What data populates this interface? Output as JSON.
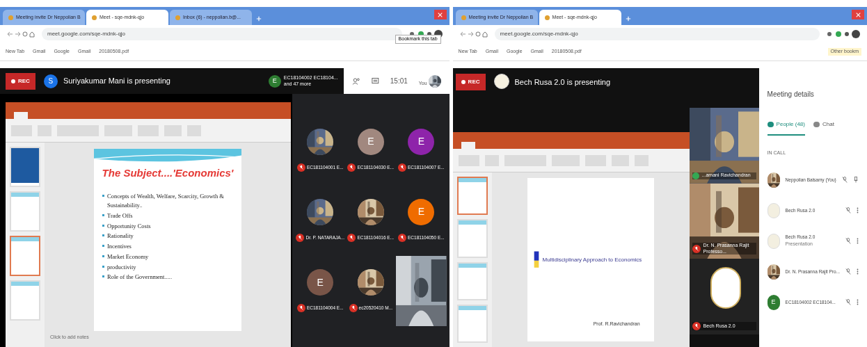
{
  "left_window": {
    "tabs": [
      {
        "title": "Meeting invite Dr Neppolian B",
        "selected": false
      },
      {
        "title": "Meet - sqe-mdnk-qjo",
        "selected": true
      },
      {
        "title": "Inbox (6) - neppolian.b@...",
        "selected": false
      }
    ],
    "url": "meet.google.com/sqe-mdnk-qjo",
    "bookmarks": [
      "New Tab",
      "Gmail",
      "Google",
      "Gmail",
      "20180508.pdf"
    ],
    "tooltip": "Bookmark this tab",
    "rec": "REC",
    "presenter": {
      "initial": "S",
      "text": "Suriyakumar Mani is presenting"
    },
    "participants": {
      "initial": "E",
      "names": "EC18104002 EC18104...",
      "more": "and 47 more"
    },
    "clock": "15:01",
    "self_label": "You",
    "slide": {
      "title": "The Subject....'Economics'",
      "bullets": [
        "Concepts of Wealth, Welfare, Scarcity, Growth & Sustainability..",
        "Trade Offs",
        "Opportunity Costs",
        "Rationality",
        "Incentives",
        "Market Economy",
        "productivity",
        "Role of the Government....."
      ]
    },
    "thumbnails": [
      {
        "selected": false
      },
      {
        "selected": false
      },
      {
        "selected": true
      },
      {
        "selected": false
      }
    ],
    "notes": "Click to add notes",
    "tiles": [
      {
        "kind": "picture",
        "name": "EC181104001 E..."
      },
      {
        "kind": "letter",
        "letter": "E",
        "color": "#a1887f",
        "name": "EC181104030 E..."
      },
      {
        "kind": "letter",
        "letter": "E",
        "color": "#8e24aa",
        "name": "EC181104007 E..."
      },
      {
        "kind": "picture",
        "name": "Dr. P. NATARAJA..."
      },
      {
        "kind": "picture",
        "name": "EC181104016 E..."
      },
      {
        "kind": "letter",
        "letter": "E",
        "color": "#ef6c00",
        "name": "EC181104050 E..."
      },
      {
        "kind": "letter",
        "letter": "E",
        "color": "#795548",
        "name": "EC181104004 E..."
      },
      {
        "kind": "picture",
        "name": "ec20520410 M..."
      },
      {
        "kind": "video"
      }
    ]
  },
  "right_window": {
    "tabs": [
      {
        "title": "Meeting invite Dr Neppolian B",
        "selected": false
      },
      {
        "title": "Meet - sqe-mdnk-qjo",
        "selected": true
      }
    ],
    "url": "meet.google.com/sqe-mdnk-qjo",
    "bookmarks": [
      "New Tab",
      "Gmail",
      "Google",
      "Gmail",
      "20180508.pdf"
    ],
    "other_bookmarks": "Other bookm",
    "rec": "REC",
    "presenter": {
      "text": "Bech Rusa 2.0 is presenting"
    },
    "slide": {
      "title": "Multidisciplinary Approach to Economics",
      "author": "Prof. R.Ravichandran"
    },
    "thumbnails": [
      {
        "selected": true
      },
      {
        "selected": false
      },
      {
        "selected": false
      },
      {
        "selected": false
      }
    ],
    "videos": [
      {
        "name": "...amani Ravichandran",
        "muted": false
      },
      {
        "name": "Dr. N. Prasanna Rajit Professo...",
        "muted": true
      },
      {
        "name": "Bech Rusa 2.0",
        "muted": true
      }
    ],
    "panel": {
      "title": "Meeting details",
      "tabs": [
        {
          "label": "People (48)",
          "selected": true
        },
        {
          "label": "Chat",
          "selected": false
        }
      ],
      "section": "IN CALL",
      "people": [
        {
          "name": "Neppolian Balsamy (You)",
          "kind": "picture",
          "pinnable": true
        },
        {
          "name": "Bech Rusa 2.0",
          "kind": "logo",
          "pinnable": false
        },
        {
          "name": "Bech Rusa 2.0",
          "sub": "Presentation",
          "kind": "logo",
          "pinnable": false
        },
        {
          "name": "Dr. N. Prasanna Rajit Pro...",
          "kind": "picture",
          "pinnable": false
        },
        {
          "name": "EC18104002 EC18104...",
          "kind": "letter",
          "letter": "E",
          "color": "#2e7d32",
          "pinnable": false
        }
      ]
    }
  }
}
